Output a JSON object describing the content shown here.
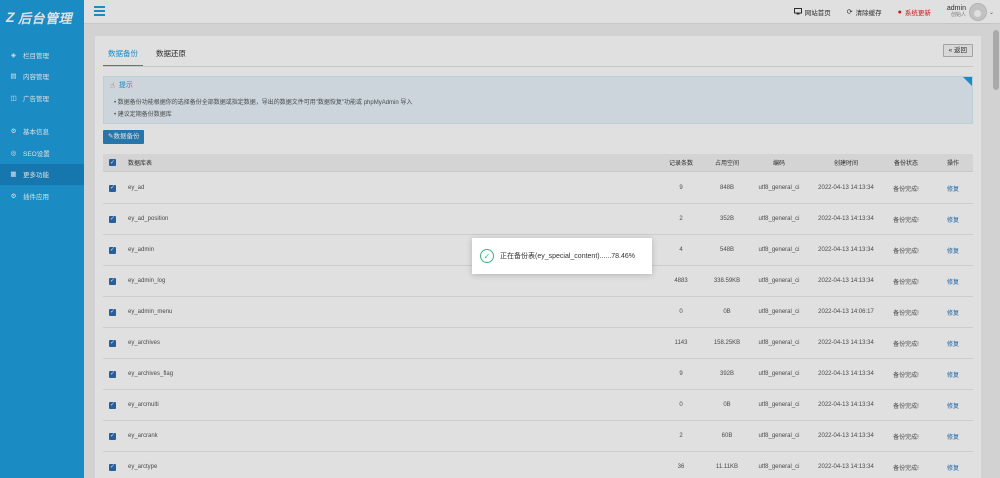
{
  "sidebar": {
    "logo": "后台管理",
    "groups": [
      [
        {
          "label": "栏目管理",
          "icon": "layers-icon"
        },
        {
          "label": "内容管理",
          "icon": "document-icon"
        },
        {
          "label": "广告管理",
          "icon": "megaphone-icon"
        }
      ],
      [
        {
          "label": "基本信息",
          "icon": "gear-icon"
        },
        {
          "label": "SEO设置",
          "icon": "seo-icon"
        },
        {
          "label": "更多功能",
          "icon": "grid-icon",
          "active": true
        },
        {
          "label": "插件应用",
          "icon": "plugin-icon"
        }
      ]
    ]
  },
  "topbar": {
    "site_home": "网站首页",
    "clear_cache": "清除缓存",
    "system_update": "系统更新",
    "user_name": "admin",
    "user_role": "创始人"
  },
  "tabs": [
    "数据备份",
    "数据还原"
  ],
  "back_label": "« 返回",
  "tip": {
    "title": "提示",
    "lines": [
      "• 数据备份功能根据你的选择备份全部数据或指定数据，导出的数据文件可用\"数据恢复\"功能或 phpMyAdmin 导入",
      "• 建议定期备份数据库"
    ]
  },
  "backup_button": "数据备份",
  "table": {
    "headers": {
      "name": "数据库表",
      "rows": "记录条数",
      "size": "占用空间",
      "encoding": "编码",
      "created": "创建时间",
      "status": "备份状态",
      "op": "操作"
    },
    "rows": [
      {
        "name": "ey_ad",
        "rows": "9",
        "size": "848B",
        "encoding": "utf8_general_ci",
        "created": "2022-04-13 14:13:34",
        "status": "备份完成!",
        "op": "修复"
      },
      {
        "name": "ey_ad_position",
        "rows": "2",
        "size": "352B",
        "encoding": "utf8_general_ci",
        "created": "2022-04-13 14:13:34",
        "status": "备份完成!",
        "op": "修复"
      },
      {
        "name": "ey_admin",
        "rows": "4",
        "size": "548B",
        "encoding": "utf8_general_ci",
        "created": "2022-04-13 14:13:34",
        "status": "备份完成!",
        "op": "修复"
      },
      {
        "name": "ey_admin_log",
        "rows": "4883",
        "size": "338.59KB",
        "encoding": "utf8_general_ci",
        "created": "2022-04-13 14:13:34",
        "status": "备份完成!",
        "op": "修复"
      },
      {
        "name": "ey_admin_menu",
        "rows": "0",
        "size": "0B",
        "encoding": "utf8_general_ci",
        "created": "2022-04-13 14:06:17",
        "status": "备份完成!",
        "op": "修复"
      },
      {
        "name": "ey_archives",
        "rows": "1143",
        "size": "158.25KB",
        "encoding": "utf8_general_ci",
        "created": "2022-04-13 14:13:34",
        "status": "备份完成!",
        "op": "修复"
      },
      {
        "name": "ey_archives_flag",
        "rows": "9",
        "size": "392B",
        "encoding": "utf8_general_ci",
        "created": "2022-04-13 14:13:34",
        "status": "备份完成!",
        "op": "修复"
      },
      {
        "name": "ey_arcmulti",
        "rows": "0",
        "size": "0B",
        "encoding": "utf8_general_ci",
        "created": "2022-04-13 14:13:34",
        "status": "备份完成!",
        "op": "修复"
      },
      {
        "name": "ey_arcrank",
        "rows": "2",
        "size": "60B",
        "encoding": "utf8_general_ci",
        "created": "2022-04-13 14:13:34",
        "status": "备份完成!",
        "op": "修复"
      },
      {
        "name": "ey_arctype",
        "rows": "36",
        "size": "11.11KB",
        "encoding": "utf8_general_ci",
        "created": "2022-04-13 14:13:34",
        "status": "备份完成!",
        "op": "修复"
      }
    ]
  },
  "toast": {
    "message": "正在备份表(ey_special_content)......78.46%"
  }
}
